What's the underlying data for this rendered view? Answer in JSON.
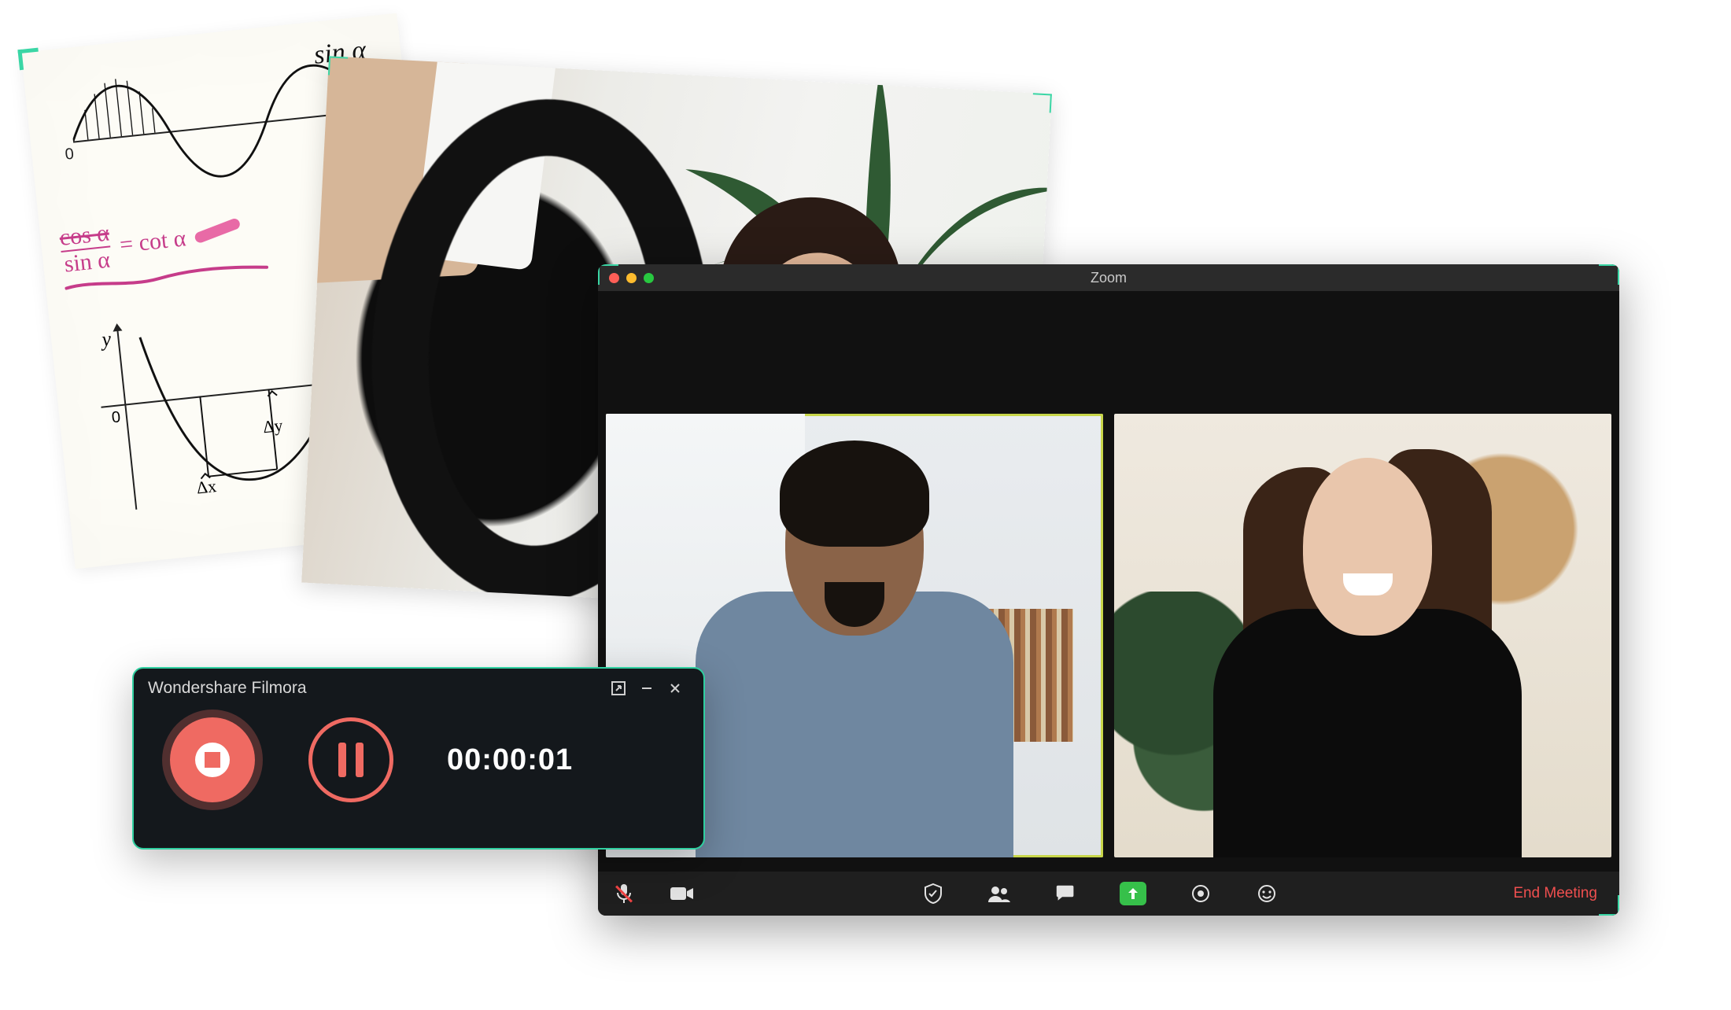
{
  "notes": {
    "top_expression": "sin α",
    "origin1": "0",
    "formula_num": "cos α",
    "formula_den": "sin α",
    "formula_eq": "= cot α",
    "y_label": "y",
    "origin2": "0",
    "dx_label": "Δx",
    "dy_label": "Δy"
  },
  "zoom": {
    "title": "Zoom",
    "end_meeting": "End Meeting",
    "toolbar_icons": {
      "mic": "microphone-icon",
      "video": "video-icon",
      "security": "shield-icon",
      "participants": "participants-icon",
      "chat": "chat-icon",
      "share": "share-screen-icon",
      "record": "record-icon",
      "reactions": "reactions-icon"
    }
  },
  "recorder": {
    "title": "Wondershare Filmora",
    "timer": "00:00:01"
  },
  "colors": {
    "accent_green": "#3ad6a5",
    "record_red": "#ef6a62",
    "zoom_green": "#36c04a",
    "end_red": "#ef4f4f"
  }
}
